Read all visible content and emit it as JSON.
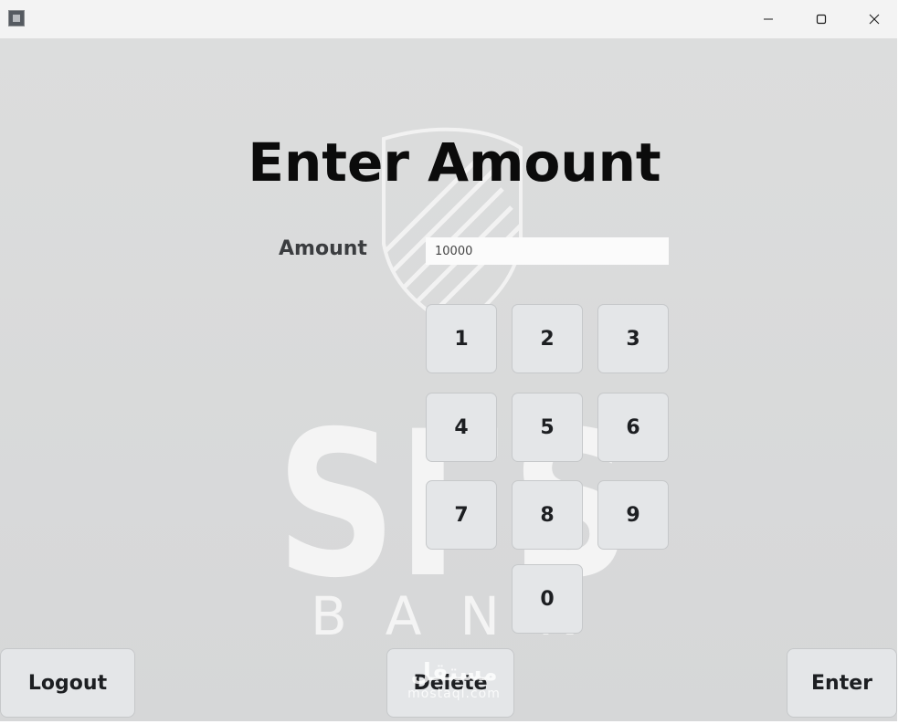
{
  "titlebar": {
    "app_icon": "app-icon",
    "minimize_icon": "minimize-icon",
    "maximize_icon": "maximize-icon",
    "close_icon": "close-icon"
  },
  "screen": {
    "title": "Enter Amount",
    "amount_label": "Amount",
    "amount_value": "10000"
  },
  "keypad": {
    "keys": [
      "1",
      "2",
      "3",
      "4",
      "5",
      "6",
      "7",
      "8",
      "9",
      "0"
    ]
  },
  "actions": {
    "logout": "Logout",
    "delete": "Delete",
    "enter": "Enter"
  },
  "watermark": {
    "logo_text": "SFS",
    "logo_subtext": "BANK",
    "site_ar": "مستقل",
    "site": "mostaql.com"
  },
  "colors": {
    "background": "#d8d9da",
    "button": "#e4e6e8",
    "title_text": "#0b0b0b"
  }
}
